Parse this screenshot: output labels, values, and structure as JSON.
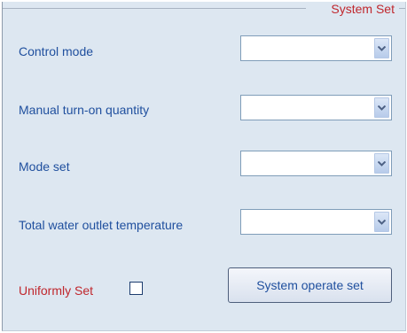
{
  "panel": {
    "title": "System Set"
  },
  "rows": [
    {
      "label": "Control mode",
      "value": ""
    },
    {
      "label": "Manual turn-on quantity",
      "value": ""
    },
    {
      "label": "Mode set",
      "value": ""
    },
    {
      "label": "Total water outlet temperature",
      "value": ""
    }
  ],
  "uniform": {
    "label": "Uniformly Set",
    "checked": false
  },
  "button": {
    "label": "System operate set"
  },
  "icons": {
    "dropdown": "chevron-down-icon"
  },
  "colors": {
    "label_blue": "#1f4f9e",
    "title_red": "#c0272d",
    "panel_bg": "#dde7f1"
  }
}
